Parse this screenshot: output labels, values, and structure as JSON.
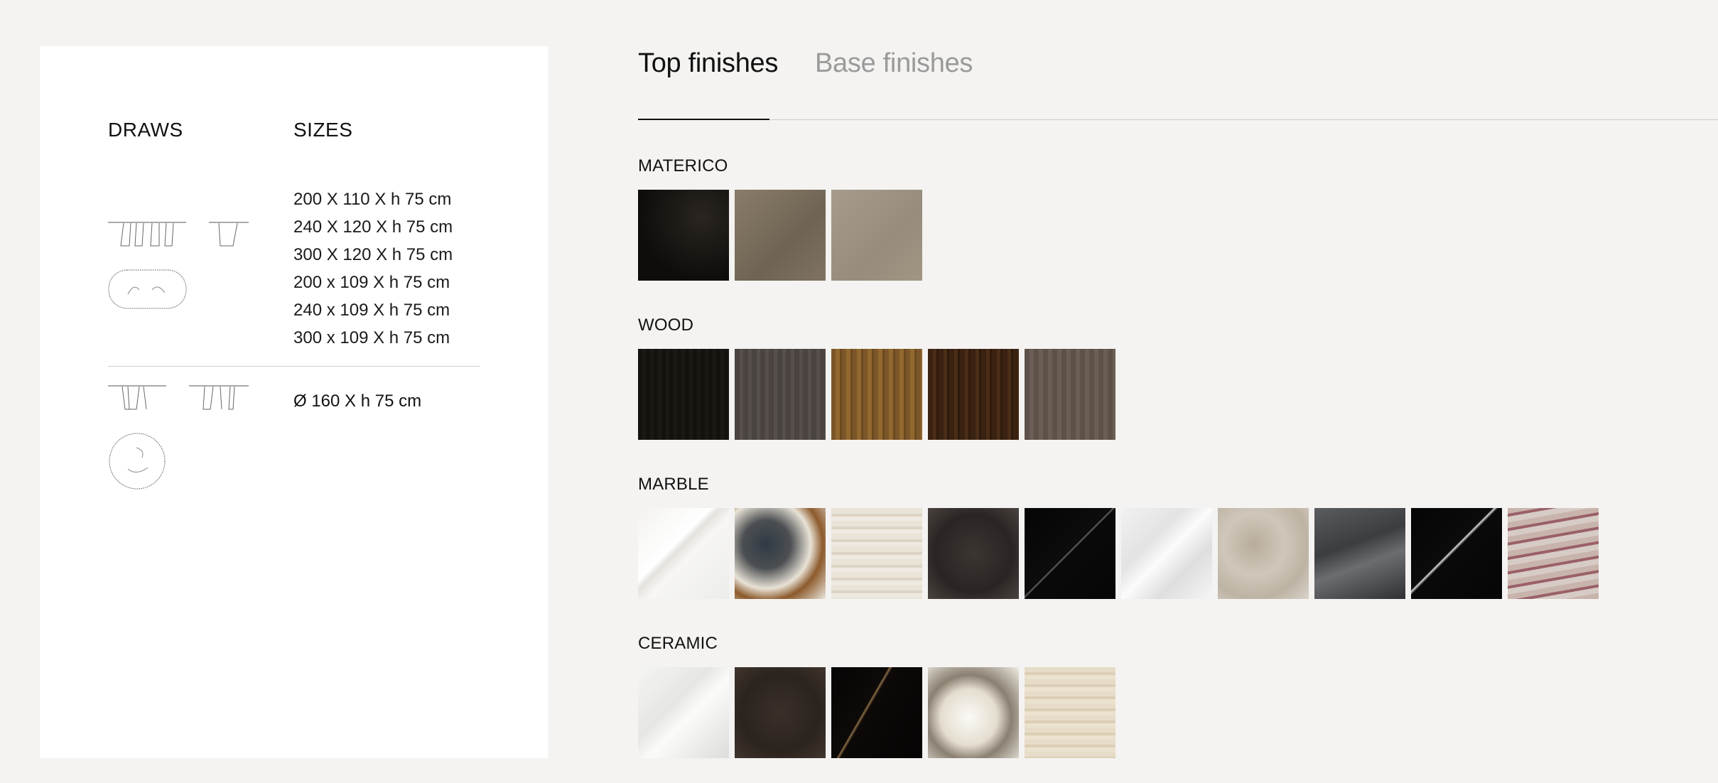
{
  "draws_heading": "DRAWS",
  "sizes_heading": "SIZES",
  "rect_sizes": [
    "200 X 110 X h 75 cm",
    "240 X 120 X h 75 cm",
    "300 X 120 X h 75 cm",
    "200 x 109 X h 75 cm",
    "240 x 109 X h 75 cm",
    "300 x 109 X h 75 cm"
  ],
  "round_size": "Ø 160 X h 75 cm",
  "tabs": {
    "top": "Top finishes",
    "base": "Base finishes",
    "active": "top"
  },
  "groups": [
    {
      "title": "MATERICO",
      "swatches": [
        {
          "name": "materico-black",
          "bg": "radial-gradient(circle at 70% 30%, #2a2520 0%, #0e0d0b 70%)"
        },
        {
          "name": "materico-bronze",
          "bg": "linear-gradient(135deg,#8a7c6a,#6f6454 60%,#7f7262)"
        },
        {
          "name": "materico-sand",
          "bg": "linear-gradient(135deg,#a69b8c,#978c7d 60%,#a19683)"
        }
      ]
    },
    {
      "title": "WOOD",
      "swatches": [
        {
          "name": "wood-black",
          "bg": "repeating-linear-gradient(90deg,#14120f 0 6px,#1c1915 6px 11px)"
        },
        {
          "name": "wood-grey",
          "bg": "repeating-linear-gradient(90deg,#4a4340 0 7px,#55504c 7px 12px)"
        },
        {
          "name": "wood-oak",
          "bg": "repeating-linear-gradient(90deg,#7b5628 0 6px,#93682f 6px 12px,#6c4a20 12px 15px)"
        },
        {
          "name": "wood-walnut",
          "bg": "repeating-linear-gradient(90deg,#3a2212 0 7px,#4b2c16 7px 12px,#2e1a0c 12px 15px)"
        },
        {
          "name": "wood-smoke",
          "bg": "repeating-linear-gradient(90deg,#5d5149 0 7px,#6a5e55 7px 13px)"
        }
      ]
    },
    {
      "title": "MARBLE",
      "swatches": [
        {
          "name": "marble-calacatta",
          "bg": "linear-gradient(135deg,#f3f2ee 0%,#ffffff 40%,#e4e3de 45%,#f7f6f3 55%,#ececea 100%)"
        },
        {
          "name": "marble-patagonia",
          "bg": "radial-gradient(circle at 35% 40%,#2f3a45 0%,#4c4f52 30%,#e8e2d6 55%,#8c5a2c 70%,#eae6de 100%)"
        },
        {
          "name": "marble-travertine",
          "bg": "repeating-linear-gradient(180deg,#e9e3d8 0 8px,#ddd4c5 8px 12px,#efeae1 12px 18px)"
        },
        {
          "name": "marble-emperador",
          "bg": "radial-gradient(circle at 50% 50%,#3b3532 0%,#2a2523 60%,#4a4340 100%)"
        },
        {
          "name": "marble-nero",
          "bg": "linear-gradient(135deg,#050505 0%,#0c0c0c 48%,#6a6a6a 49%,#0a0a0a 50%,#060606 100%)"
        },
        {
          "name": "marble-statuario",
          "bg": "linear-gradient(135deg,#f1f1f1 0%,#e3e3e3 35%,#fbfbfb 50%,#dedede 70%,#f5f5f5 100%)"
        },
        {
          "name": "marble-grey-onyx",
          "bg": "radial-gradient(circle at 40% 40%,#b8ad9c 0%,#cfc7ba 40%,#bdb3a4 70%,#d9d3ca 100%)"
        },
        {
          "name": "marble-storm",
          "bg": "linear-gradient(160deg,#5a5c60 0%,#3b3d40 40%,#6b6d70 60%,#2f3033 100%)"
        },
        {
          "name": "marble-black-white",
          "bg": "linear-gradient(135deg,#050505 0%,#0b0b0b 45%,#d9d9d9 46%,#0a0a0a 48%,#050505 100%)"
        },
        {
          "name": "marble-rosso",
          "bg": "repeating-linear-gradient(170deg,#c8b4ac 0 8px,#9a6068 8px 12px,#d7cbc5 12px 20px)"
        }
      ]
    },
    {
      "title": "CERAMIC",
      "swatches": [
        {
          "name": "ceramic-white-vein",
          "bg": "linear-gradient(135deg,#f4f4f2 0%,#e6e6e4 40%,#fbfbfa 55%,#dcdcda 100%)"
        },
        {
          "name": "ceramic-brown-marble",
          "bg": "radial-gradient(circle at 50% 50%,#3a302a 0%,#2b231e 60%,#41362e 100%)"
        },
        {
          "name": "ceramic-sahara-noir",
          "bg": "linear-gradient(120deg,#060505 0%,#0d0a08 40%,#8a6b45 41%,#0c0907 43%,#050404 100%)"
        },
        {
          "name": "ceramic-patagonia",
          "bg": "radial-gradient(circle at 45% 55%,#fbfaf6 0%,#e4ddcf 40%,#8a8072 60%,#f0ece3 100%)"
        },
        {
          "name": "ceramic-travertine",
          "bg": "repeating-linear-gradient(180deg,#e7dcc7 0 7px,#dccfb6 7px 11px,#ebe2cf 11px 17px)"
        }
      ]
    }
  ]
}
